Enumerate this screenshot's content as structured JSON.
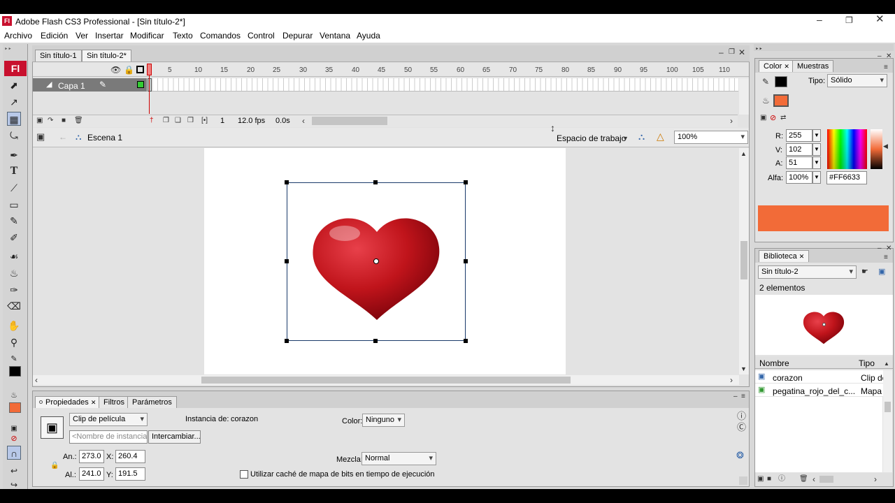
{
  "window": {
    "title": "Adobe Flash CS3 Professional - [Sin título-2*]",
    "logo": "Fl"
  },
  "menu": [
    "Archivo",
    "Edición",
    "Ver",
    "Insertar",
    "Modificar",
    "Texto",
    "Comandos",
    "Control",
    "Depurar",
    "Ventana",
    "Ayuda"
  ],
  "doc_tabs": [
    "Sin título-1",
    "Sin título-2*"
  ],
  "timeline": {
    "layer_name": "Capa 1",
    "frame_numbers": [
      "5",
      "10",
      "15",
      "20",
      "25",
      "30",
      "35",
      "40",
      "45",
      "50",
      "55",
      "60",
      "65",
      "70",
      "75",
      "80",
      "85",
      "90",
      "95",
      "100",
      "105",
      "110"
    ],
    "current_frame": "1",
    "fps": "12.0 fps",
    "time": "0.0s"
  },
  "edit_bar": {
    "scene": "Escena 1",
    "workspace_label": "Espacio de trabajo",
    "zoom": "100%"
  },
  "properties": {
    "tabs": [
      "Propiedades",
      "Filtros",
      "Parámetros"
    ],
    "symbol_type": "Clip de película",
    "instance_name_placeholder": "<Nombre de instancia>",
    "swap_label": "Intercambiar...",
    "instance_of_label": "Instancia de:",
    "instance_of_value": "corazon",
    "color_label": "Color:",
    "color_value": "Ninguno",
    "blend_label": "Mezcla:",
    "blend_value": "Normal",
    "width_label": "An.:",
    "width_value": "273.0",
    "height_label": "Al.:",
    "height_value": "241.0",
    "x_label": "X:",
    "x_value": "260.4",
    "y_label": "Y:",
    "y_value": "191.5",
    "cache_label": "Utilizar caché de mapa de bits en tiempo de ejecución"
  },
  "color_panel": {
    "tabs": [
      "Color",
      "Muestras"
    ],
    "type_label": "Tipo:",
    "type_value": "Sólido",
    "r_label": "R:",
    "r_value": "255",
    "g_label": "V:",
    "g_value": "102",
    "b_label": "A:",
    "b_value": "51",
    "alpha_label": "Alfa:",
    "alpha_value": "100%",
    "hex": "#FF6633",
    "swatch_color": "#f26b38"
  },
  "library": {
    "tab": "Biblioteca",
    "doc": "Sin título-2",
    "count": "2 elementos",
    "col_name": "Nombre",
    "col_type": "Tipo",
    "items": [
      {
        "name": "corazon",
        "type": "Clip de"
      },
      {
        "name": "pegatina_rojo_del_c...",
        "type": "Mapa"
      }
    ]
  },
  "colors": {
    "accent": "#f26b38",
    "heart": "#c0141b",
    "logo_bg": "#c8102e"
  }
}
